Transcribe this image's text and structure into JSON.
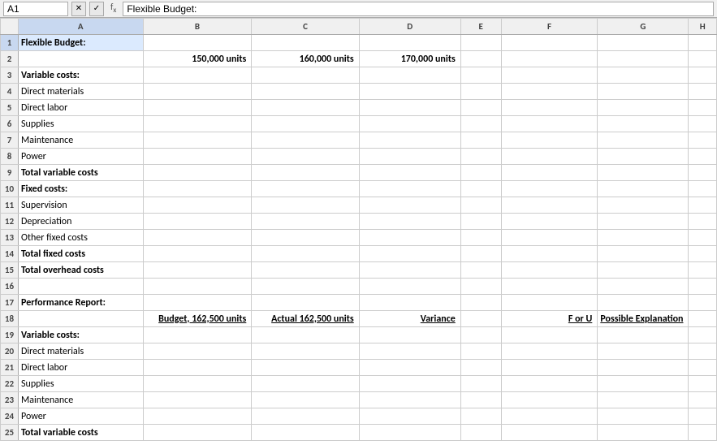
{
  "formulaBar": {
    "nameBox": "A1",
    "formulaContent": "Flexible Budget:"
  },
  "columns": [
    "",
    "A",
    "B",
    "C",
    "D",
    "E",
    "F",
    "G",
    "H"
  ],
  "rows": [
    {
      "num": 1,
      "cells": [
        "Flexible Budget:",
        "",
        "",
        "",
        "",
        "",
        "",
        ""
      ]
    },
    {
      "num": 2,
      "cells": [
        "",
        "150,000 units",
        "160,000 units",
        "170,000 units",
        "",
        "",
        "",
        ""
      ]
    },
    {
      "num": 3,
      "cells": [
        "Variable costs:",
        "",
        "",
        "",
        "",
        "",
        "",
        ""
      ]
    },
    {
      "num": 4,
      "cells": [
        "Direct materials",
        "",
        "",
        "",
        "",
        "",
        "",
        ""
      ]
    },
    {
      "num": 5,
      "cells": [
        "Direct labor",
        "",
        "",
        "",
        "",
        "",
        "",
        ""
      ]
    },
    {
      "num": 6,
      "cells": [
        "Supplies",
        "",
        "",
        "",
        "",
        "",
        "",
        ""
      ]
    },
    {
      "num": 7,
      "cells": [
        "Maintenance",
        "",
        "",
        "",
        "",
        "",
        "",
        ""
      ]
    },
    {
      "num": 8,
      "cells": [
        "Power",
        "",
        "",
        "",
        "",
        "",
        "",
        ""
      ]
    },
    {
      "num": 9,
      "cells": [
        "Total variable costs",
        "",
        "",
        "",
        "",
        "",
        "",
        ""
      ]
    },
    {
      "num": 10,
      "cells": [
        "Fixed costs:",
        "",
        "",
        "",
        "",
        "",
        "",
        ""
      ]
    },
    {
      "num": 11,
      "cells": [
        "Supervision",
        "",
        "",
        "",
        "",
        "",
        "",
        ""
      ]
    },
    {
      "num": 12,
      "cells": [
        "Depreciation",
        "",
        "",
        "",
        "",
        "",
        "",
        ""
      ]
    },
    {
      "num": 13,
      "cells": [
        "Other fixed costs",
        "",
        "",
        "",
        "",
        "",
        "",
        ""
      ]
    },
    {
      "num": 14,
      "cells": [
        "Total fixed costs",
        "",
        "",
        "",
        "",
        "",
        "",
        ""
      ]
    },
    {
      "num": 15,
      "cells": [
        "Total overhead costs",
        "",
        "",
        "",
        "",
        "",
        "",
        ""
      ]
    },
    {
      "num": 16,
      "cells": [
        "",
        "",
        "",
        "",
        "",
        "",
        "",
        ""
      ]
    },
    {
      "num": 17,
      "cells": [
        "Performance Report:",
        "",
        "",
        "",
        "",
        "",
        "",
        ""
      ]
    },
    {
      "num": 18,
      "cells": [
        "",
        "Budget, 162,500 units",
        "Actual 162,500 units",
        "Variance",
        "",
        "F or U",
        "Possible Explanation",
        ""
      ]
    },
    {
      "num": 19,
      "cells": [
        "Variable costs:",
        "",
        "",
        "",
        "",
        "",
        "",
        ""
      ]
    },
    {
      "num": 20,
      "cells": [
        "Direct materials",
        "",
        "",
        "",
        "",
        "",
        "",
        ""
      ]
    },
    {
      "num": 21,
      "cells": [
        "Direct labor",
        "",
        "",
        "",
        "",
        "",
        "",
        ""
      ]
    },
    {
      "num": 22,
      "cells": [
        "Supplies",
        "",
        "",
        "",
        "",
        "",
        "",
        ""
      ]
    },
    {
      "num": 23,
      "cells": [
        "Maintenance",
        "",
        "",
        "",
        "",
        "",
        "",
        ""
      ]
    },
    {
      "num": 24,
      "cells": [
        "Power",
        "",
        "",
        "",
        "",
        "",
        "",
        ""
      ]
    },
    {
      "num": 25,
      "cells": [
        "Total variable costs",
        "",
        "",
        "",
        "",
        "",
        "",
        ""
      ]
    }
  ],
  "boldRows": [
    1,
    2,
    3,
    9,
    10,
    14,
    15,
    17,
    18,
    19,
    25
  ],
  "boldCells": {}
}
